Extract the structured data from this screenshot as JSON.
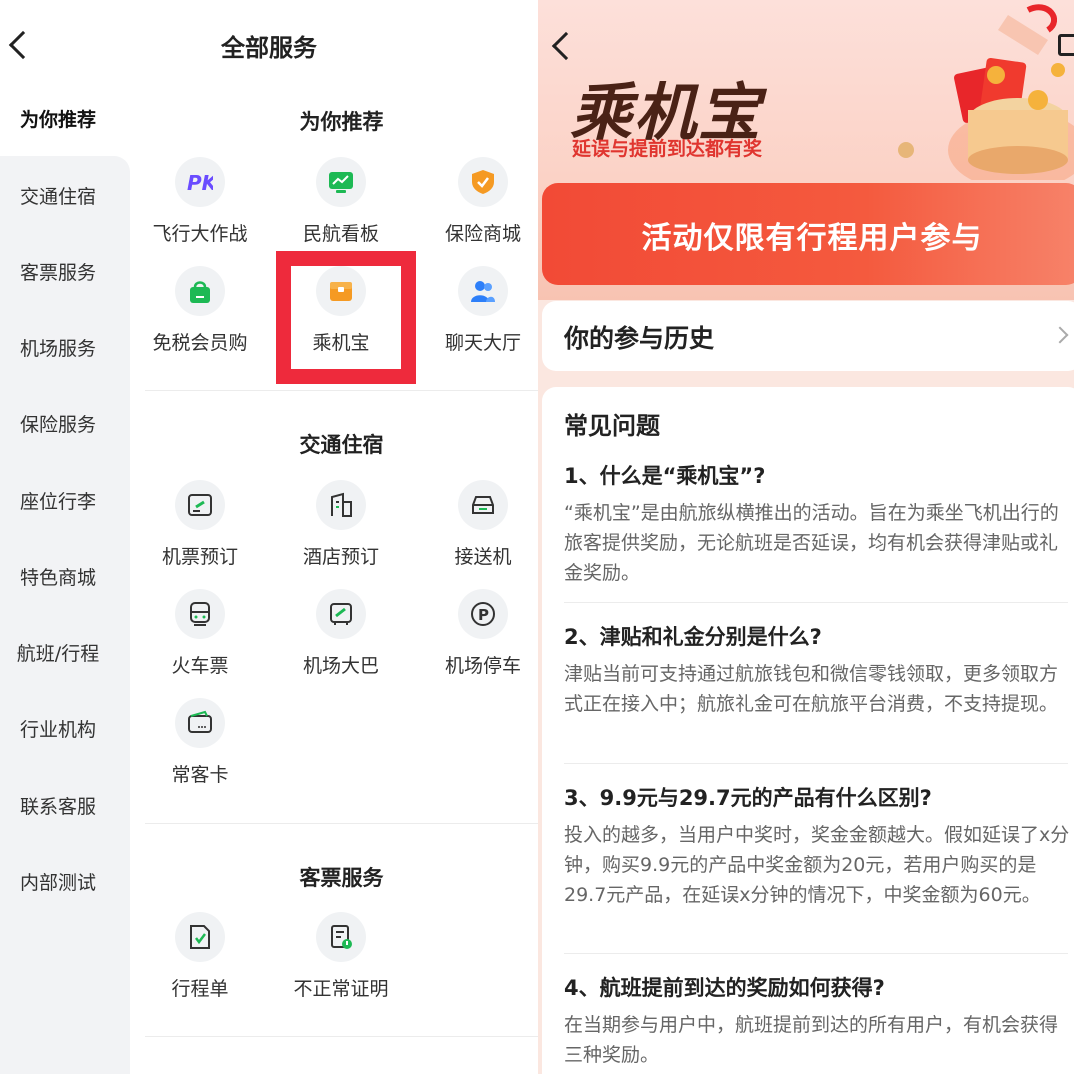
{
  "left": {
    "title": "全部服务",
    "sidebar": [
      {
        "label": "为你推荐",
        "active": true
      },
      {
        "label": "交通住宿"
      },
      {
        "label": "客票服务"
      },
      {
        "label": "机场服务"
      },
      {
        "label": "保险服务"
      },
      {
        "label": "座位行李"
      },
      {
        "label": "特色商城"
      },
      {
        "label": "航班/行程"
      },
      {
        "label": "行业机构"
      },
      {
        "label": "联系客服"
      },
      {
        "label": "内部测试"
      }
    ],
    "sections": [
      {
        "title": "为你推荐",
        "items": [
          {
            "label": "飞行大作战",
            "icon": "pk-icon"
          },
          {
            "label": "民航看板",
            "icon": "dashboard-icon"
          },
          {
            "label": "保险商城",
            "icon": "shield-icon"
          },
          {
            "label": "免税会员购",
            "icon": "shopping-bag-icon"
          },
          {
            "label": "乘机宝",
            "icon": "treasure-box-icon"
          },
          {
            "label": "聊天大厅",
            "icon": "users-icon"
          }
        ]
      },
      {
        "title": "交通住宿",
        "items": [
          {
            "label": "机票预订",
            "icon": "ticket-icon"
          },
          {
            "label": "酒店预订",
            "icon": "hotel-icon"
          },
          {
            "label": "接送机",
            "icon": "car-icon"
          },
          {
            "label": "火车票",
            "icon": "train-icon"
          },
          {
            "label": "机场大巴",
            "icon": "bus-icon"
          },
          {
            "label": "机场停车",
            "icon": "parking-icon"
          },
          {
            "label": "常客卡",
            "icon": "card-icon"
          }
        ]
      },
      {
        "title": "客票服务",
        "items": [
          {
            "label": "行程单",
            "icon": "itinerary-icon"
          },
          {
            "label": "不正常证明",
            "icon": "certificate-icon"
          }
        ]
      }
    ],
    "colors": {
      "green": "#1db954",
      "highlight": "#ee2a3c",
      "sidebar_bg": "#f2f3f5"
    }
  },
  "right": {
    "brand_title": "乘机宝",
    "brand_subtitle": "延误与提前到达都有奖",
    "banner": "活动仅限有行程用户参与",
    "history_label": "你的参与历史",
    "faq_title": "常见问题",
    "faq": [
      {
        "q": "1、什么是“乘机宝”?",
        "a": "“乘机宝”是由航旅纵横推出的活动。旨在为乘坐飞机出行的旅客提供奖励，无论航班是否延误，均有机会获得津贴或礼金奖励。"
      },
      {
        "q": "2、津贴和礼金分别是什么?",
        "a": "津贴当前可支持通过航旅钱包和微信零钱领取，更多领取方式正在接入中；航旅礼金可在航旅平台消费，不支持提现。"
      },
      {
        "q": "3、9.9元与29.7元的产品有什么区别?",
        "a": "投入的越多，当用户中奖时，奖金金额越大。假如延误了x分钟，购买9.9元的产品中奖金额为20元，若用户购买的是29.7元产品，在延误x分钟的情况下，中奖金额为60元。"
      },
      {
        "q": "4、航班提前到达的奖励如何获得?",
        "a": "在当期参与用户中，航班提前到达的所有用户，有机会获得三种奖励。"
      }
    ],
    "colors": {
      "banner": "#f24a36",
      "brand_text": "#4a2216",
      "accent_red": "#e0352f"
    }
  }
}
